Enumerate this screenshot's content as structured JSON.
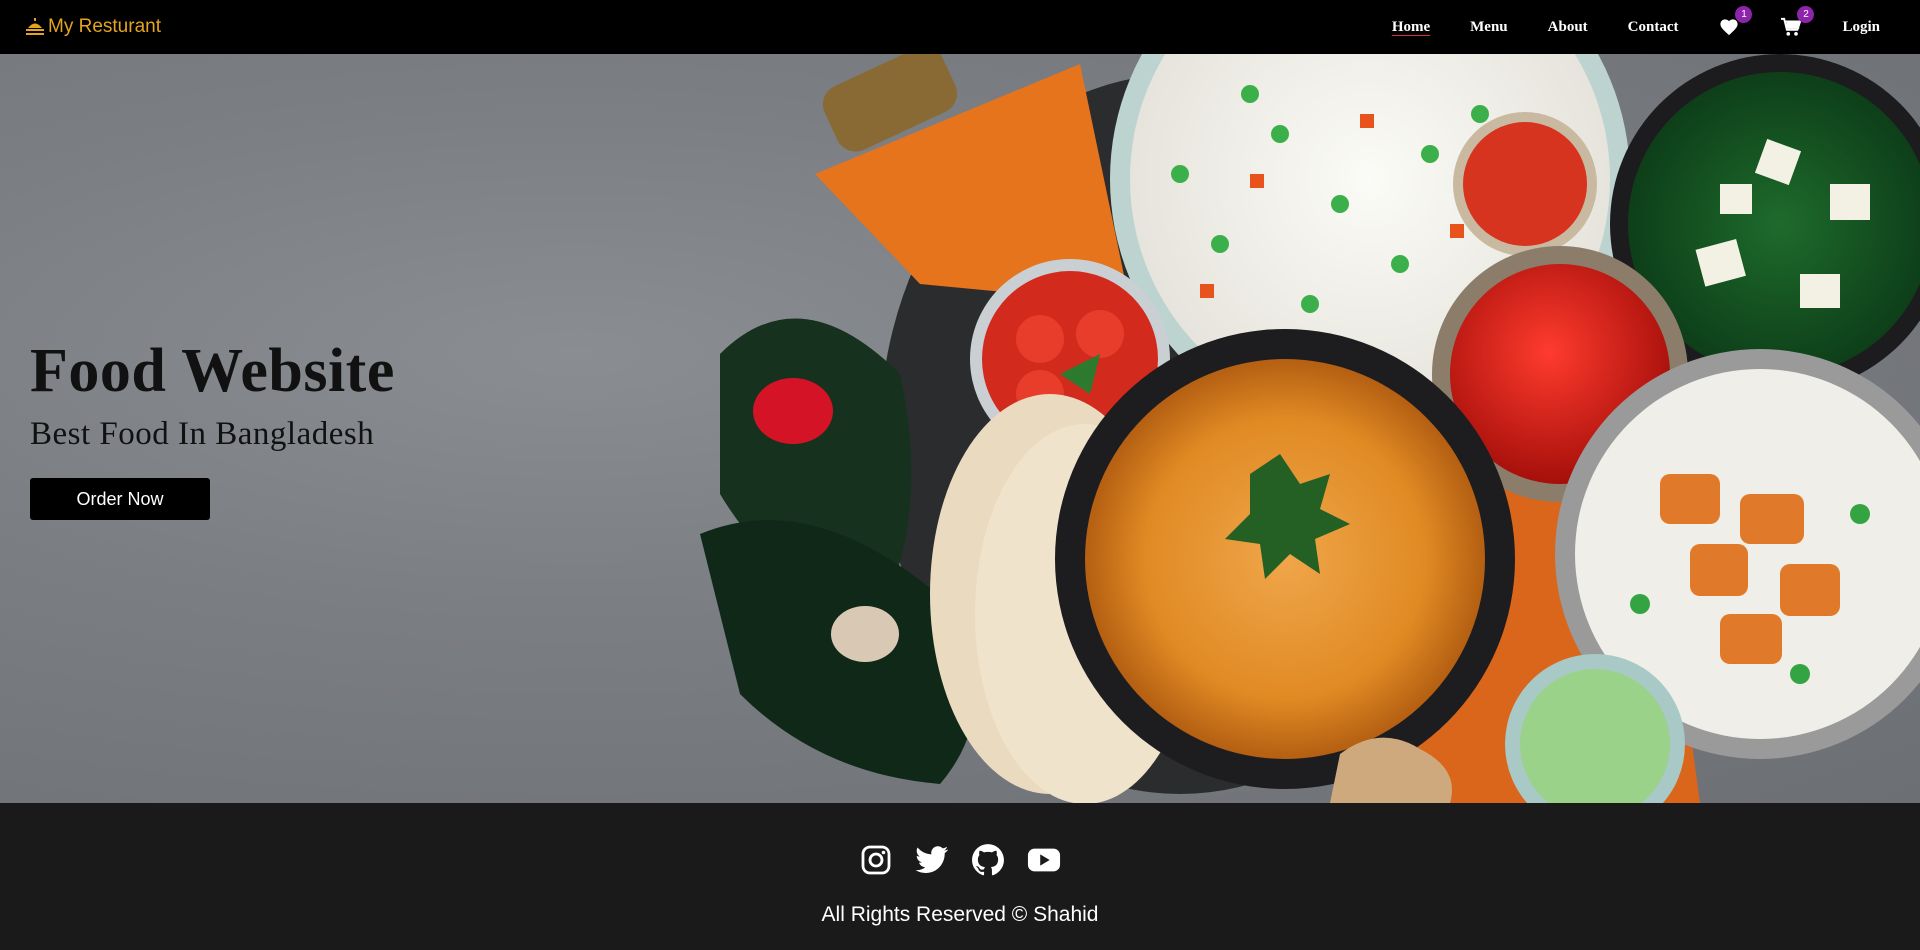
{
  "navbar": {
    "brand": "My Resturant",
    "links": [
      "Home",
      "Menu",
      "About",
      "Contact",
      "Login"
    ],
    "wishlist_count": "1",
    "cart_count": "2"
  },
  "hero": {
    "title": "Food Website",
    "subtitle": "Best Food In Bangladesh",
    "order_button": "Order Now"
  },
  "footer": {
    "socials": [
      "instagram-icon",
      "twitter-icon",
      "github-icon",
      "youtube-icon"
    ],
    "copyright": "All Rights Reserved © Shahid"
  },
  "colors": {
    "brand": "#e3a41e",
    "navbar_bg": "#000000",
    "footer_bg": "#1a1a1a",
    "badge": "#8e24aa",
    "active_underline": "#d32f2f"
  }
}
